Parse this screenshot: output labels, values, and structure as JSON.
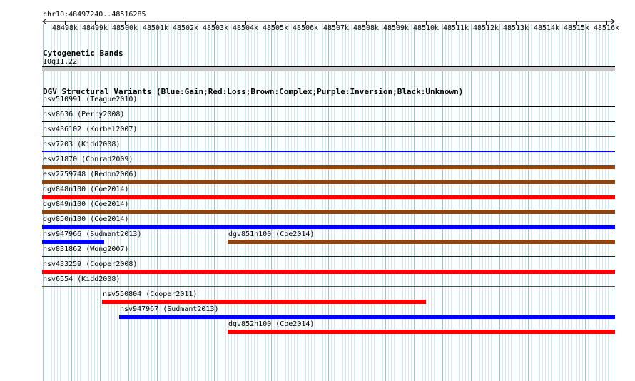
{
  "browser": {
    "location": "chr10:48497240..48516285",
    "ruler_labels": [
      "48498k",
      "48499k",
      "48500k",
      "48501k",
      "48502k",
      "48503k",
      "48504k",
      "48505k",
      "48506k",
      "48507k",
      "48508k",
      "48509k",
      "48510k",
      "48511k",
      "48512k",
      "48513k",
      "48514k",
      "48515k",
      "48516k"
    ]
  },
  "cytoband": {
    "title": "Cytogenetic Bands",
    "band": "10q11.22"
  },
  "dgv": {
    "title": "DGV Structural Variants (Blue:Gain;Red:Loss;Brown:Complex;Purple:Inversion;Black:Unknown)",
    "colors": {
      "gain": "#0000ff",
      "loss": "#ff0000",
      "complex": "#8b4513",
      "unknown": "#000000"
    },
    "features": [
      {
        "label": "nsv510991 (Teague2010)",
        "type": "unknown",
        "start": 48497240,
        "end": 48516285
      },
      {
        "label": "nsv8636 (Perry2008)",
        "type": "unknown",
        "start": 48497240,
        "end": 48516285
      },
      {
        "label": "nsv436102 (Korbel2007)",
        "type": "loss",
        "start": 48497240,
        "end": 48516285
      },
      {
        "label": "nsv7203 (Kidd2008)",
        "type": "gain",
        "start": 48497240,
        "end": 48516285
      },
      {
        "label": "esv21870 (Conrad2009)",
        "type": "complex",
        "start": 48497240,
        "end": 48516285
      },
      {
        "label": "esv2759748 (Redon2006)",
        "type": "complex",
        "start": 48497240,
        "end": 48516285
      },
      {
        "label": "dgv848n100 (Coe2014)",
        "type": "loss",
        "start": 48497240,
        "end": 48516285
      },
      {
        "label": "dgv849n100 (Coe2014)",
        "type": "complex",
        "start": 48497240,
        "end": 48516285
      },
      {
        "label": "dgv850n100 (Coe2014)",
        "type": "gain",
        "start": 48497240,
        "end": 48516285
      },
      {
        "label": "nsv947966 (Sudmant2013)",
        "type": "gain",
        "start": 48497240,
        "end": 48499300
      },
      {
        "label": "dgv851n100 (Coe2014)",
        "type": "complex",
        "start": 48503400,
        "end": 48516285
      },
      {
        "label": "nsv831862 (Wong2007)",
        "type": "gain",
        "start": 48497240,
        "end": 48516285
      },
      {
        "label": "nsv433259 (Cooper2008)",
        "type": "loss",
        "start": 48497240,
        "end": 48516285
      },
      {
        "label": "nsv6554 (Kidd2008)",
        "type": "loss",
        "start": 48497240,
        "end": 48516285
      },
      {
        "label": "nsv550804 (Cooper2011)",
        "type": "loss",
        "start": 48499240,
        "end": 48510000
      },
      {
        "label": "nsv947967 (Sudmant2013)",
        "type": "gain",
        "start": 48499800,
        "end": 48516285
      },
      {
        "label": "dgv852n100 (Coe2014)",
        "type": "loss",
        "start": 48503400,
        "end": 48516285
      }
    ]
  }
}
